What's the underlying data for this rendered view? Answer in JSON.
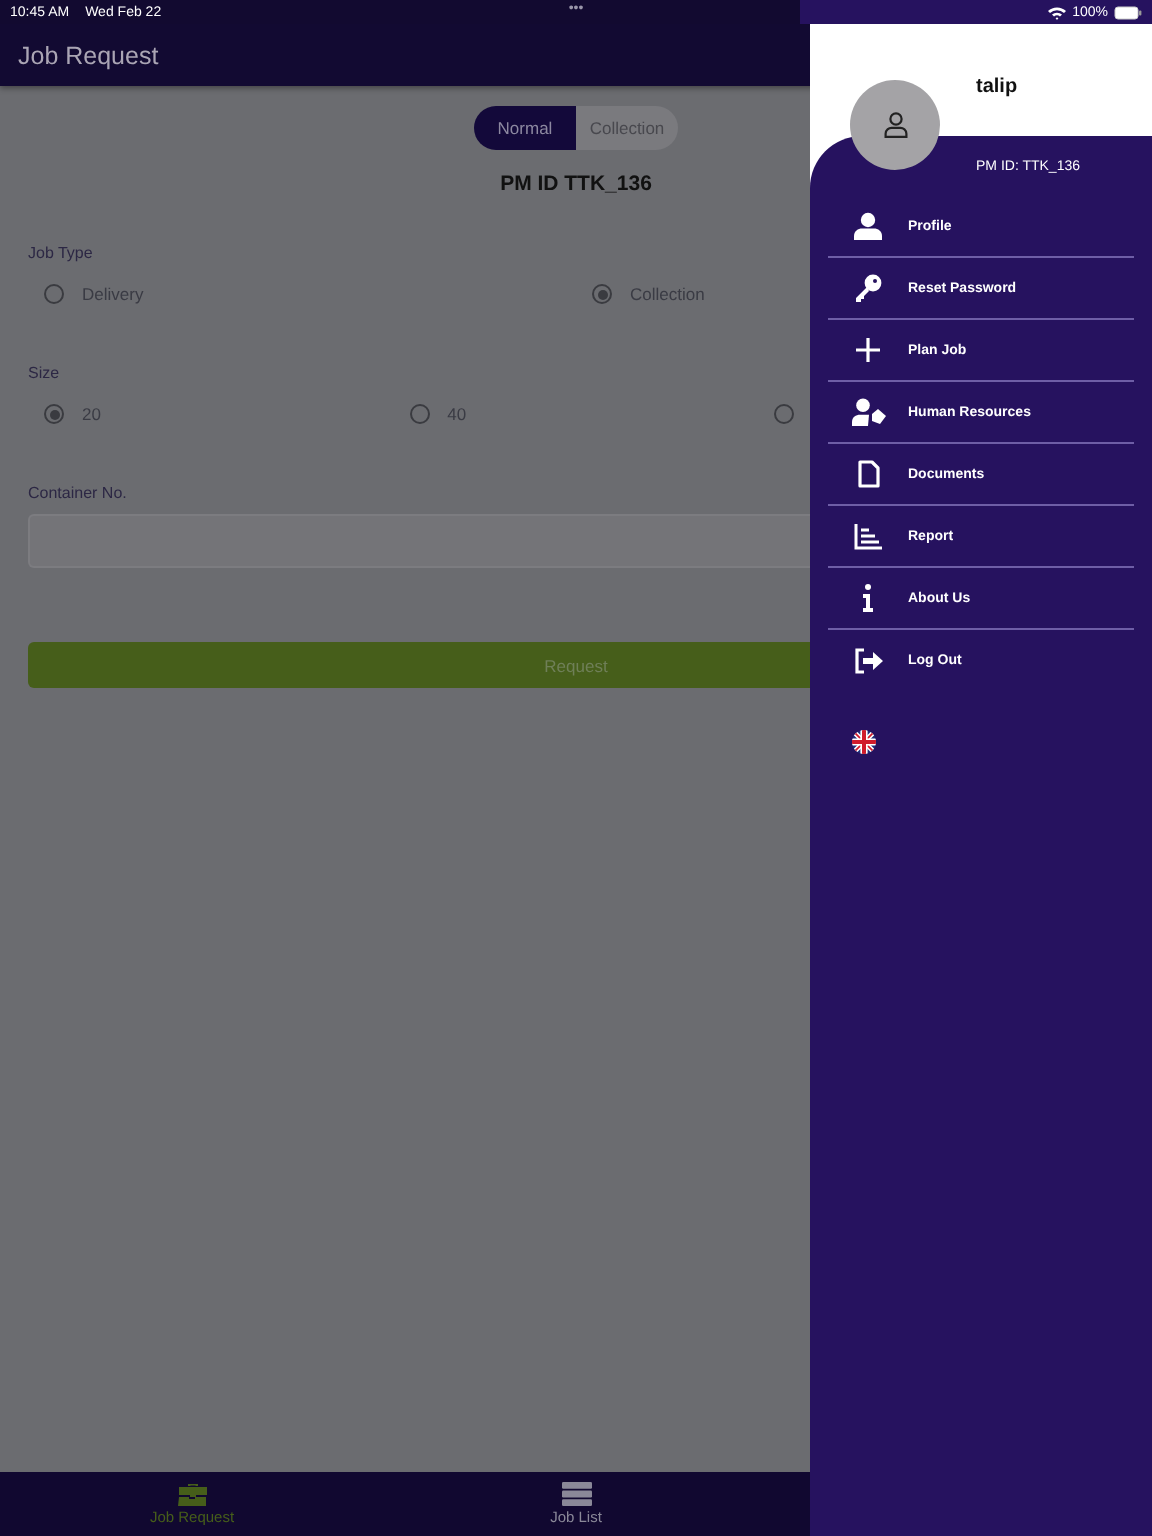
{
  "status_bar": {
    "time": "10:45 AM",
    "date": "Wed Feb 22",
    "dots": "•••",
    "battery": "100%"
  },
  "header": {
    "title": "Job Request"
  },
  "mode_toggle": [
    {
      "label": "Normal",
      "selected": true
    },
    {
      "label": "Collection",
      "selected": false
    }
  ],
  "pm_id": "PM ID TTK_136",
  "job_type": {
    "label": "Job Type",
    "options": [
      {
        "label": "Delivery",
        "selected": false
      },
      {
        "label": "Collection",
        "selected": true
      }
    ]
  },
  "size": {
    "label": "Size",
    "options": [
      {
        "label": "20",
        "selected": true
      },
      {
        "label": "40",
        "selected": false
      },
      {
        "selected": false
      }
    ]
  },
  "container_no": {
    "label": "Container No."
  },
  "request_button": {
    "label": "Request"
  },
  "bottom_tabs": [
    {
      "label": "Job Request",
      "selected": true
    },
    {
      "label": "Job List",
      "selected": false
    }
  ],
  "drawer": {
    "user_name": "talip",
    "pm_id": "PM ID: TTK_136",
    "menu": [
      {
        "label": "Profile"
      },
      {
        "label": "Reset Password"
      },
      {
        "label": "Plan Job"
      },
      {
        "label": "Human Resources"
      },
      {
        "label": "Documents"
      },
      {
        "label": "Report"
      },
      {
        "label": "About Us"
      },
      {
        "label": "Log Out"
      }
    ]
  }
}
